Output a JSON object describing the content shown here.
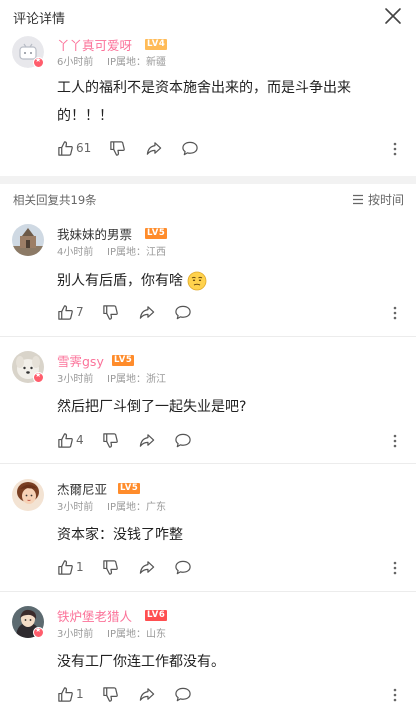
{
  "header": {
    "title": "评论详情"
  },
  "main_comment": {
    "username": "丫丫真可爱呀",
    "level": "LV4",
    "time": "6小时前",
    "ip": "IP属地：新疆",
    "content_line1": "工人的福利不是资本施舍出来的，而是斗争出来",
    "content_line2": "的！！！",
    "likes": "61"
  },
  "replies_header": {
    "count_text": "相关回复共19条",
    "sort_label": "按时间"
  },
  "replies": [
    {
      "username": "我妹妹的男票",
      "level": "LV5",
      "time": "4小时前",
      "ip": "IP属地：江西",
      "content": "别人有后盾，你有啥",
      "likes": "7"
    },
    {
      "username": "雪霁gsy",
      "level": "LV5",
      "time": "3小时前",
      "ip": "IP属地：浙江",
      "content": "然后把厂斗倒了一起失业是吧?",
      "likes": "4"
    },
    {
      "username": "杰爾尼亚",
      "level": "LV5",
      "time": "3小时前",
      "ip": "IP属地：广东",
      "content": "资本家：没钱了咋整",
      "likes": "1"
    },
    {
      "username": "铁炉堡老猎人",
      "level": "LV6",
      "time": "3小时前",
      "ip": "IP属地：山东",
      "content": "没有工厂你连工作都没有。",
      "likes": "1"
    }
  ],
  "colors": {
    "vip_pink": "#fb7299",
    "lv4": "#ffbb57",
    "lv5": "#ff8c2b",
    "lv6": "#ff4f50",
    "band": "#f2f2f2"
  },
  "icons": [
    "close-icon",
    "thumb-up-icon",
    "thumb-down-icon",
    "share-icon",
    "reply-bubble-icon",
    "more-vertical-icon",
    "sort-icon",
    "emoji-icon"
  ]
}
